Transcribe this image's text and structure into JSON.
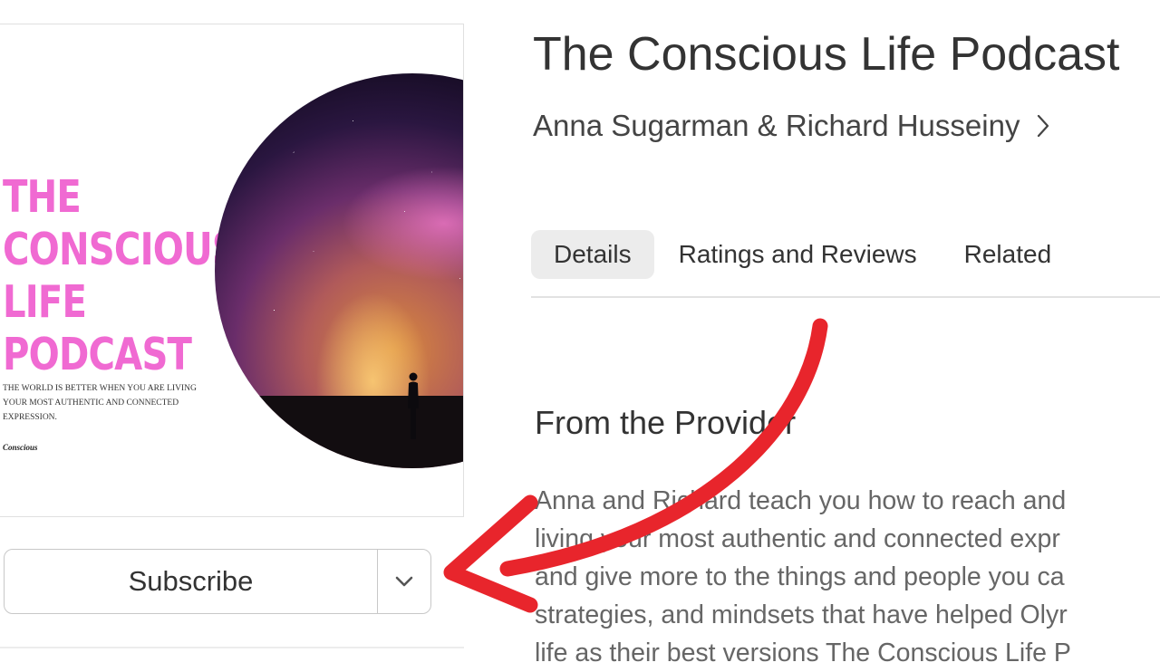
{
  "artwork": {
    "title_lines": [
      "THE",
      "CONSCIOUS",
      "LIFE",
      "PODCAST"
    ],
    "tagline": "The world is better when you are living your most authentic and connected expression.",
    "logo_text": "Conscious"
  },
  "podcast": {
    "title": "The Conscious Life Podcast",
    "authors": "Anna Sugarman & Richard Husseiny"
  },
  "tabs": [
    {
      "label": "Details",
      "active": true
    },
    {
      "label": "Ratings and Reviews",
      "active": false
    },
    {
      "label": "Related",
      "active": false
    }
  ],
  "provider": {
    "heading": "From the Provider",
    "description_lines": [
      "Anna and Richard teach you how to reach and",
      "living your most authentic and connected expr",
      "and give more to the things and people you ca",
      "strategies, and mindsets that have helped Olyr",
      "life as their best versions The Conscious Life P"
    ]
  },
  "subscribe": {
    "label": "Subscribe"
  },
  "colors": {
    "art_title": "#f06ad2",
    "annotation_arrow": "#e8252c",
    "active_tab_bg": "#ececec"
  },
  "icons": {
    "authors_link": "chevron-right-icon",
    "subscribe_menu": "chevron-down-icon",
    "annotation": "curved-arrow-icon"
  }
}
